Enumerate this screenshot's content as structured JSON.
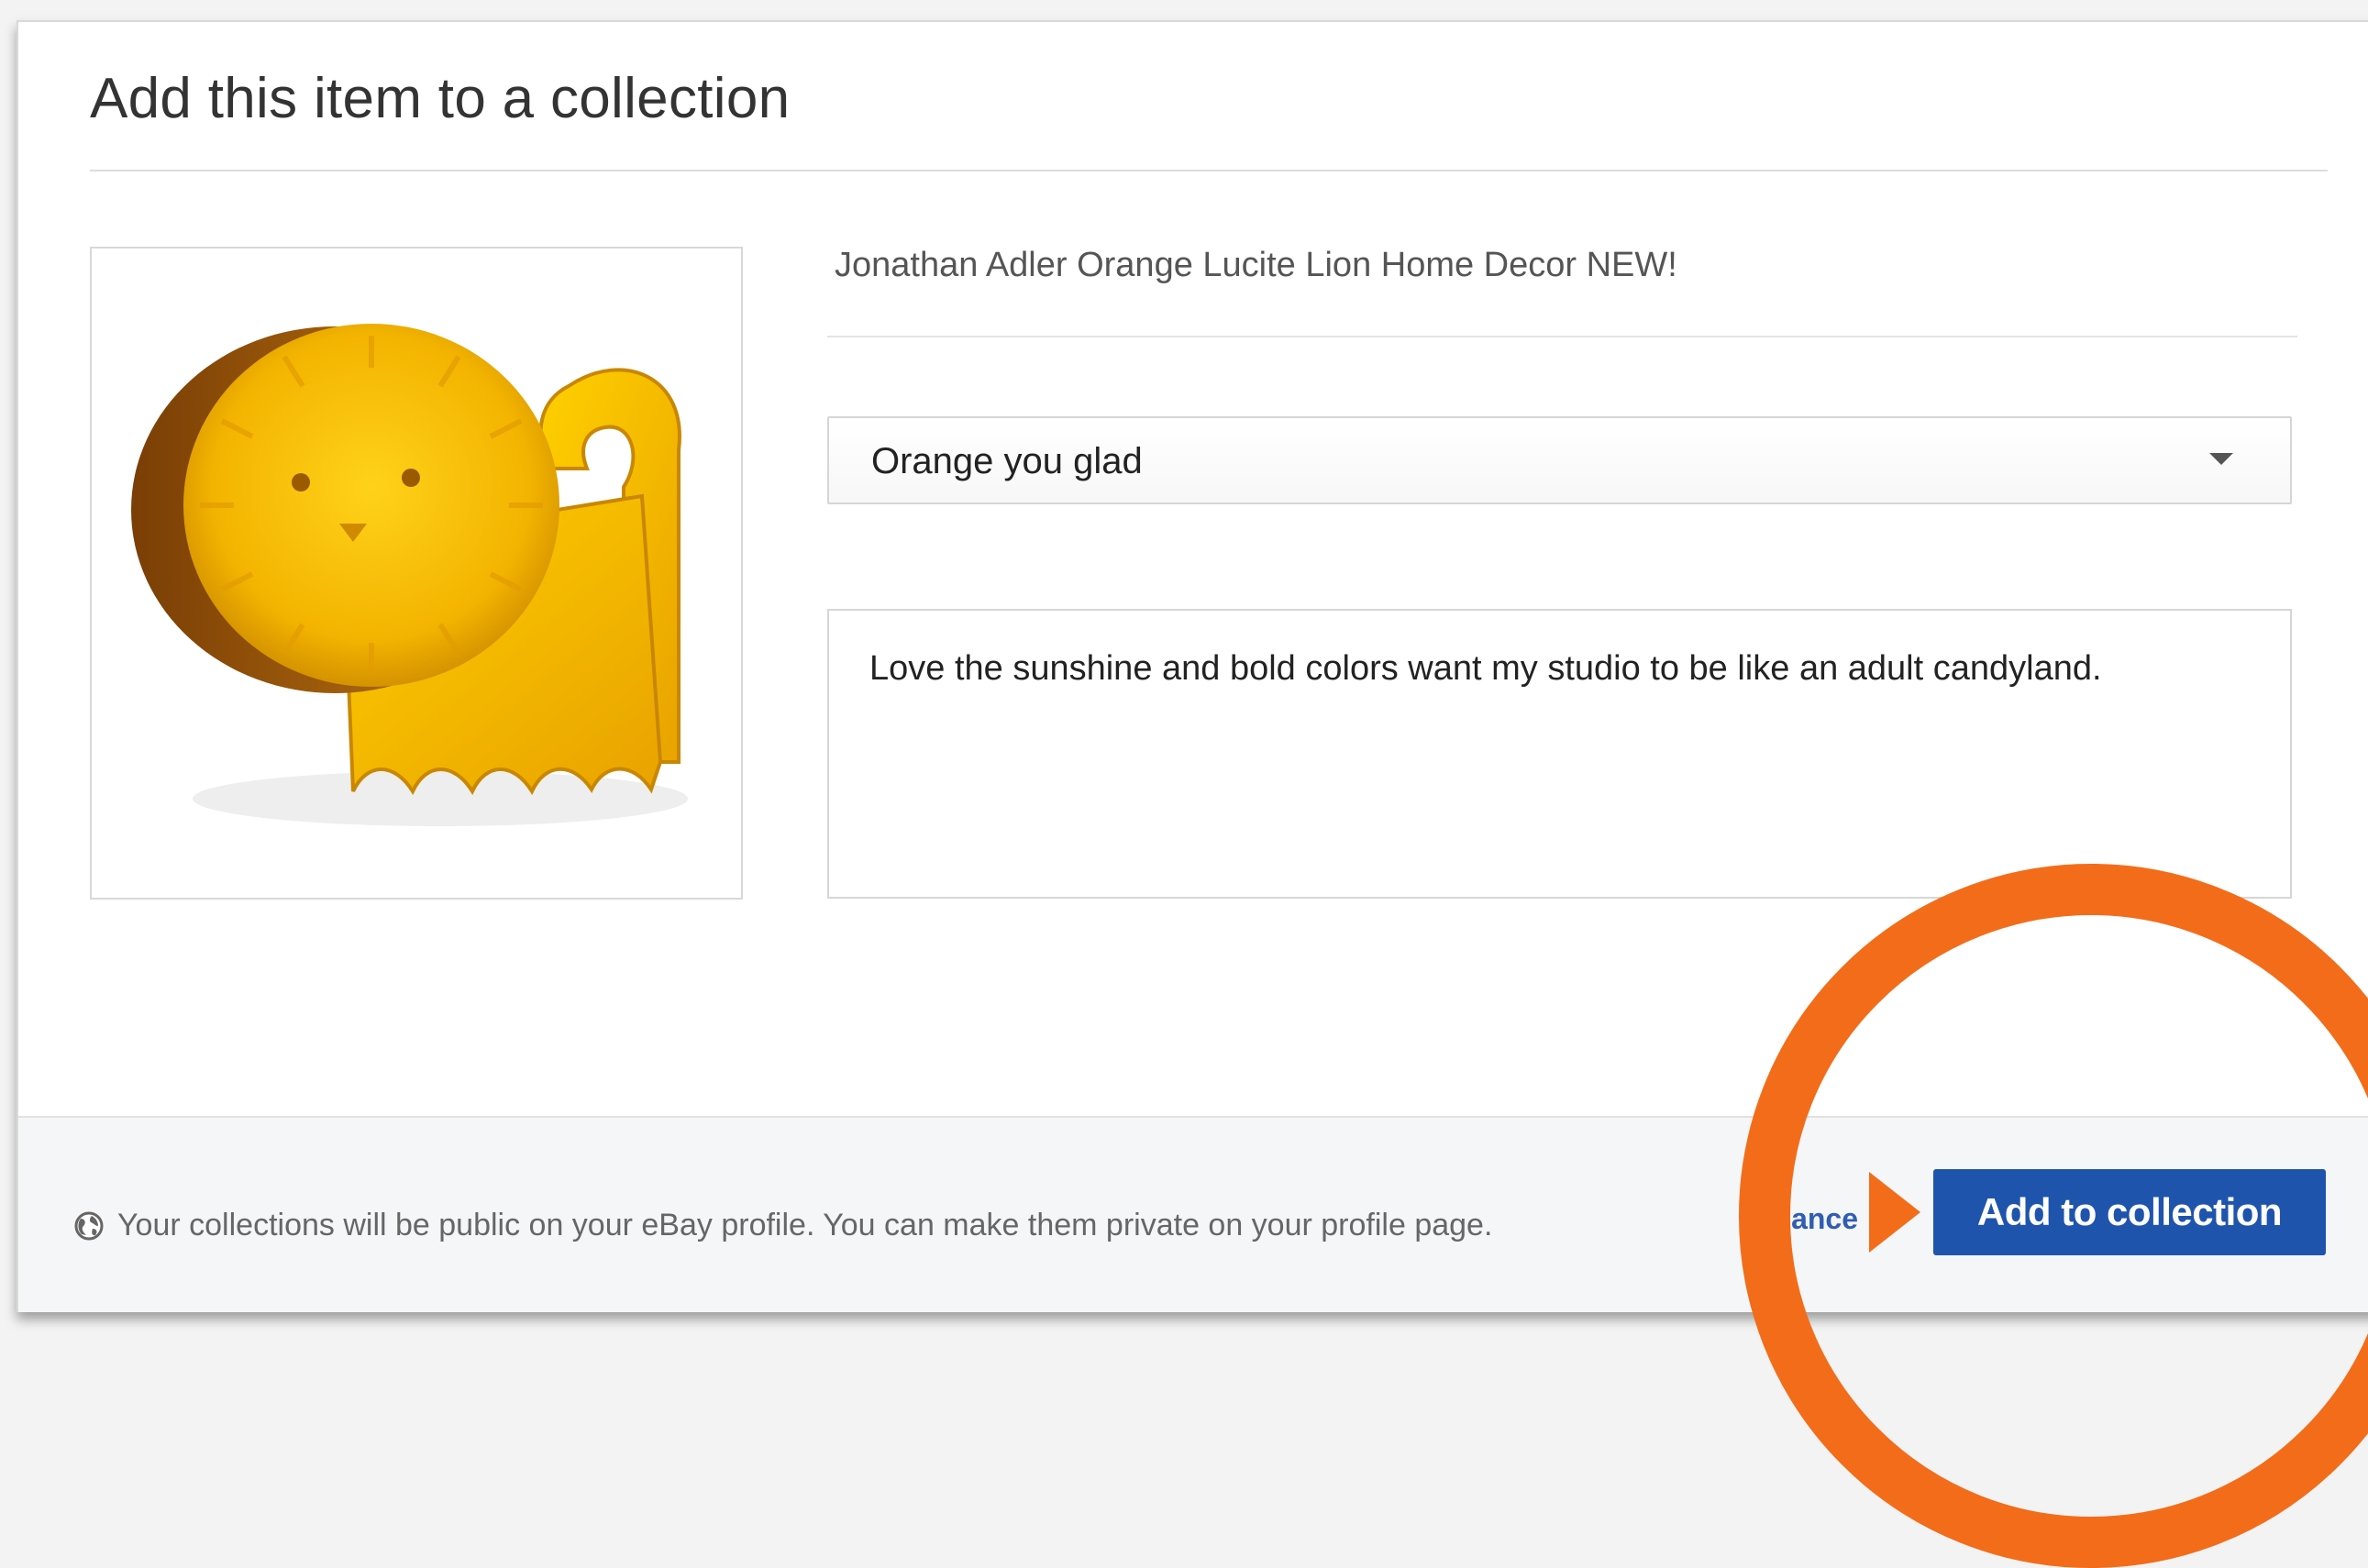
{
  "dialog": {
    "title": "Add this item to a collection"
  },
  "item": {
    "title": "Jonathan Adler Orange Lucite Lion Home Decor NEW!"
  },
  "collection_select": {
    "selected": "Orange you glad"
  },
  "note": {
    "value": "Love the sunshine and bold colors want my studio to be like an adult candyland."
  },
  "footer": {
    "privacy_note": "Your collections will be public on your eBay profile. You can make them private on your profile page.",
    "cancel_label": "Cance",
    "add_label": "Add to collection"
  },
  "colors": {
    "primary_button": "#1f54ad",
    "annotation_orange": "#f36c1a",
    "link_blue": "#2f5eb2"
  },
  "icons": {
    "footer_note": "globe-icon",
    "select": "chevron-down-icon"
  }
}
